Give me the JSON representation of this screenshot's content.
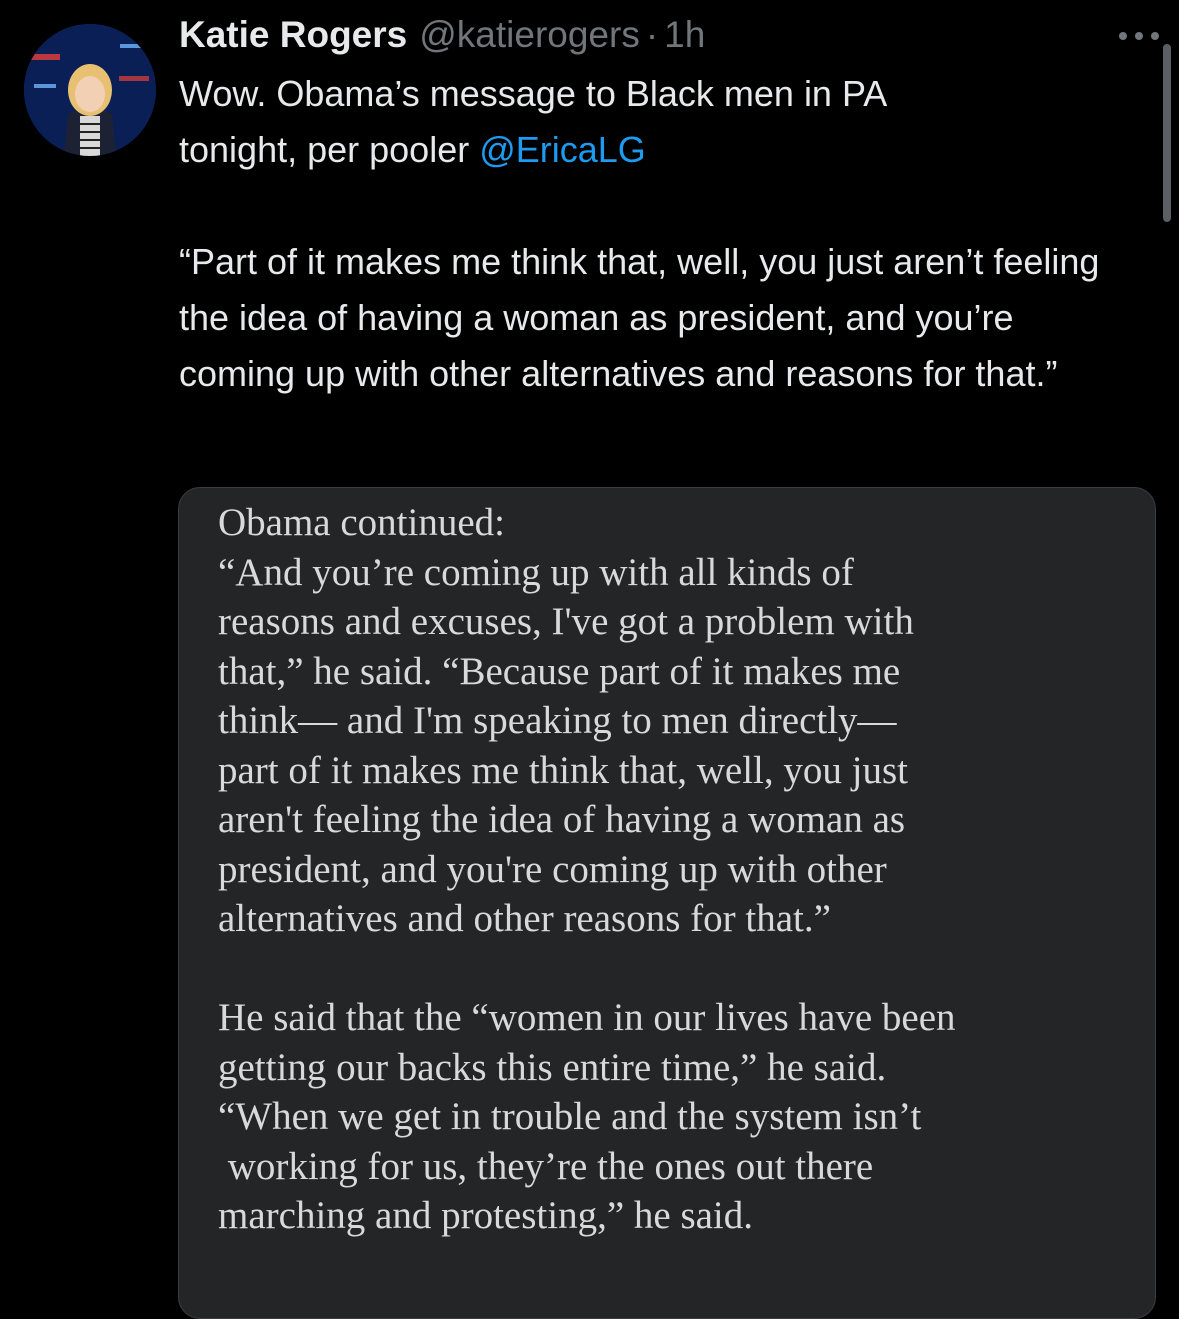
{
  "tweet": {
    "author_name": "Katie Rogers",
    "author_handle": "@katierogers",
    "separator": "·",
    "time": "1h",
    "text_before_mention": "Wow. Obama’s message to Black men in PA\ntonight, per pooler ",
    "mention": "@EricaLG",
    "quote": "“Part of it makes me think that, well, you just aren’t feeling the idea of having a woman as president, and you’re coming up with other alternatives and reasons for that.”"
  },
  "media": {
    "lines": [
      "Obama continued:",
      "“And you’re coming up with all kinds of",
      "reasons and excuses, I've got a problem with",
      "that,” he said. “Because part of it makes me",
      "think— and I'm speaking to men directly—",
      "part of it makes me think that, well, you just",
      "aren't feeling the idea of having a woman as",
      "president, and you're coming up with other",
      "alternatives and other reasons for that.”",
      "",
      "He said that the “women in our lives have been",
      "getting our backs this entire time,” he said.",
      "“When we get in trouble and the system isn’t",
      " working for us, they’re the ones out there",
      "marching and protesting,” he said."
    ]
  },
  "icons": {
    "more": "more-horizontal-icon",
    "avatar": "profile-photo"
  },
  "colors": {
    "background": "#000000",
    "text": "#e7e9ea",
    "secondary": "#71767b",
    "link": "#1d9bf0",
    "media_bg": "#242527"
  }
}
